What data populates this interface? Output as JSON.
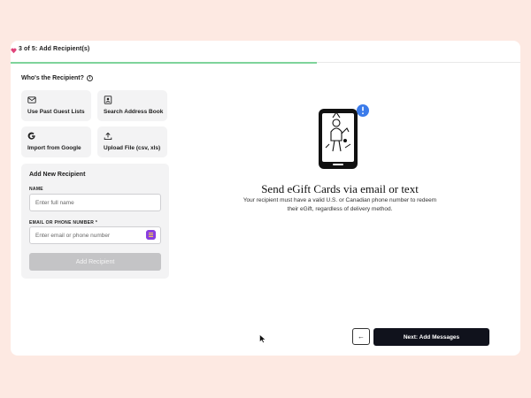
{
  "colors": {
    "background": "#fde9e2",
    "progress": "#7ed39b",
    "primary_button": "#10121c",
    "disabled_button": "#c4c4c6",
    "badge": "#8a3ee0",
    "notification": "#3b7bea"
  },
  "header": {
    "step_icon": "gift-icon",
    "step_text": "3 of 5: Add Recipient(s)",
    "progress_fraction": 0.6
  },
  "recipient_section": {
    "title": "Who's the Recipient?",
    "info_icon": "info-icon",
    "info_glyph": "i",
    "options": [
      {
        "icon": "guest-list-icon",
        "label": "Use Past Guest Lists"
      },
      {
        "icon": "address-book-icon",
        "label": "Search Address Book"
      },
      {
        "icon": "google-icon",
        "label": "Import from Google"
      },
      {
        "icon": "upload-icon",
        "label": "Upload File (csv, xls)"
      }
    ]
  },
  "add_new": {
    "title": "Add New Recipient",
    "name_label": "NAME",
    "name_placeholder": "Enter full name",
    "contact_label": "EMAIL OR PHONE NUMBER *",
    "contact_placeholder": "Enter email or phone number",
    "submit_label": "Add Recipient"
  },
  "info_panel": {
    "illustration": "phone-illustration",
    "title": "Send eGift Cards via email or text",
    "description": "Your recipient must have a valid U.S. or Canadian phone number to redeem their eGift, regardless of delivery method."
  },
  "footer": {
    "back_glyph": "←",
    "next_label": "Next: Add Messages"
  }
}
